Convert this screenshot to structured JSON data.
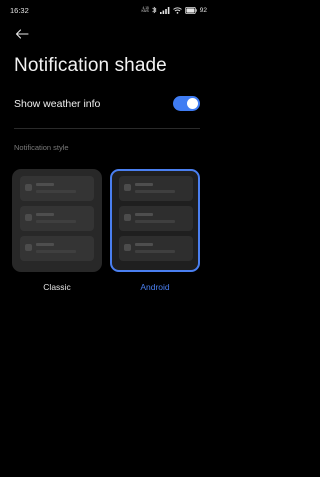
{
  "status_bar": {
    "time": "16:32",
    "net_speed_value": "4.15",
    "net_speed_unit": "KB/S",
    "battery": "92"
  },
  "page": {
    "title": "Notification shade"
  },
  "weather_setting": {
    "label": "Show weather info",
    "enabled": true
  },
  "notification_style": {
    "section_label": "Notification style",
    "options": [
      {
        "label": "Classic",
        "selected": false
      },
      {
        "label": "Android",
        "selected": true
      }
    ]
  },
  "colors": {
    "background": "#000000",
    "accent": "#3f7cf3",
    "selected_text": "#4a7ff0"
  },
  "icons": [
    "back-arrow-icon",
    "bluetooth-icon",
    "signal-icon",
    "wifi-icon",
    "battery-icon"
  ]
}
